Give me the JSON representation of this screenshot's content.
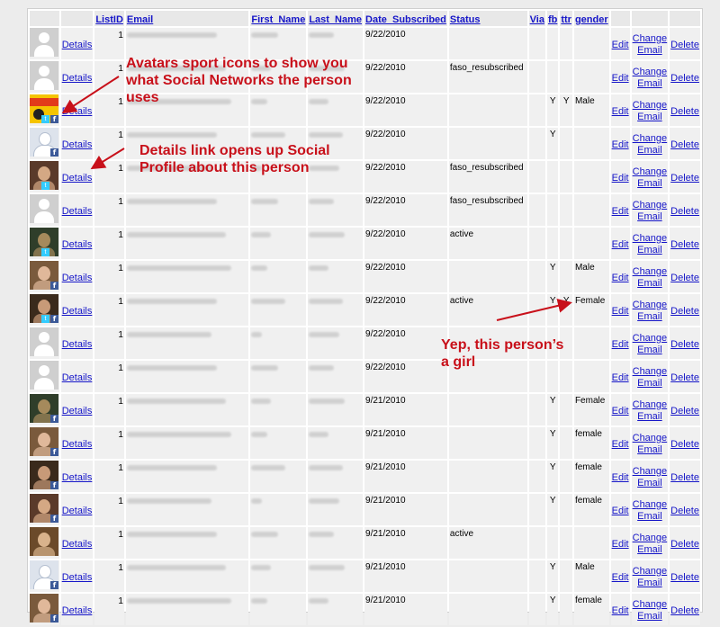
{
  "columns": [
    "ListID",
    "Email",
    "First_Name",
    "Last_Name",
    "Date_Subscribed",
    "Status",
    "Via",
    "fb",
    "ttr",
    "gender"
  ],
  "action_labels": {
    "details": "Details",
    "edit": "Edit",
    "change_line1": "Change",
    "change_line2": "Email",
    "delete": "Delete"
  },
  "annotations": {
    "avatars_line1": "Avatars sport icons to show you",
    "avatars_line2": "what Social Networks the person",
    "avatars_line3": "uses",
    "details_line1": "Details link opens up Social",
    "details_line2": "Profile about this person",
    "girl_line1": "Yep, this person’s",
    "girl_line2": "a girl"
  },
  "colors": {
    "annotation": "#c8101a",
    "link": "#1515c8",
    "cell": "#f0f0f0"
  },
  "rows": [
    {
      "avatar": "default",
      "list_id": "1",
      "date": "9/22/2010",
      "status": "",
      "via": "",
      "fb": "",
      "ttr": "",
      "gender": ""
    },
    {
      "avatar": "default",
      "list_id": "1",
      "date": "9/22/2010",
      "status": "faso_resubscribed",
      "via": "",
      "fb": "",
      "ttr": "",
      "gender": ""
    },
    {
      "avatar": "logo-photo",
      "list_id": "1",
      "date": "9/22/2010",
      "status": "",
      "via": "",
      "fb": "Y",
      "ttr": "Y",
      "gender": "Male"
    },
    {
      "avatar": "silhouette-fb",
      "list_id": "1",
      "date": "9/22/2010",
      "status": "",
      "via": "",
      "fb": "Y",
      "ttr": "",
      "gender": ""
    },
    {
      "avatar": "photo-tw",
      "list_id": "1",
      "date": "9/22/2010",
      "status": "faso_resubscribed",
      "via": "",
      "fb": "",
      "ttr": "",
      "gender": ""
    },
    {
      "avatar": "default",
      "list_id": "1",
      "date": "9/22/2010",
      "status": "faso_resubscribed",
      "via": "",
      "fb": "",
      "ttr": "",
      "gender": ""
    },
    {
      "avatar": "photo-tw",
      "list_id": "1",
      "date": "9/22/2010",
      "status": "active",
      "via": "",
      "fb": "",
      "ttr": "",
      "gender": ""
    },
    {
      "avatar": "photo-fb",
      "list_id": "1",
      "date": "9/22/2010",
      "status": "",
      "via": "",
      "fb": "Y",
      "ttr": "",
      "gender": "Male"
    },
    {
      "avatar": "photo-fb-tw",
      "list_id": "1",
      "date": "9/22/2010",
      "status": "active",
      "via": "",
      "fb": "Y",
      "ttr": "Y",
      "gender": "Female"
    },
    {
      "avatar": "default",
      "list_id": "1",
      "date": "9/22/2010",
      "status": "",
      "via": "",
      "fb": "",
      "ttr": "",
      "gender": ""
    },
    {
      "avatar": "default",
      "list_id": "1",
      "date": "9/22/2010",
      "status": "",
      "via": "",
      "fb": "",
      "ttr": "",
      "gender": ""
    },
    {
      "avatar": "photo-fb",
      "list_id": "1",
      "date": "9/21/2010",
      "status": "",
      "via": "",
      "fb": "Y",
      "ttr": "",
      "gender": "Female"
    },
    {
      "avatar": "photo-fb",
      "list_id": "1",
      "date": "9/21/2010",
      "status": "",
      "via": "",
      "fb": "Y",
      "ttr": "",
      "gender": "female"
    },
    {
      "avatar": "photo-fb",
      "list_id": "1",
      "date": "9/21/2010",
      "status": "",
      "via": "",
      "fb": "Y",
      "ttr": "",
      "gender": "female"
    },
    {
      "avatar": "photo-fb",
      "list_id": "1",
      "date": "9/21/2010",
      "status": "",
      "via": "",
      "fb": "Y",
      "ttr": "",
      "gender": "female"
    },
    {
      "avatar": "photo",
      "list_id": "1",
      "date": "9/21/2010",
      "status": "active",
      "via": "",
      "fb": "",
      "ttr": "",
      "gender": ""
    },
    {
      "avatar": "silhouette-fb",
      "list_id": "1",
      "date": "9/21/2010",
      "status": "",
      "via": "",
      "fb": "Y",
      "ttr": "",
      "gender": "Male"
    },
    {
      "avatar": "photo-fb",
      "list_id": "1",
      "date": "9/21/2010",
      "status": "",
      "via": "",
      "fb": "Y",
      "ttr": "",
      "gender": "female"
    }
  ]
}
